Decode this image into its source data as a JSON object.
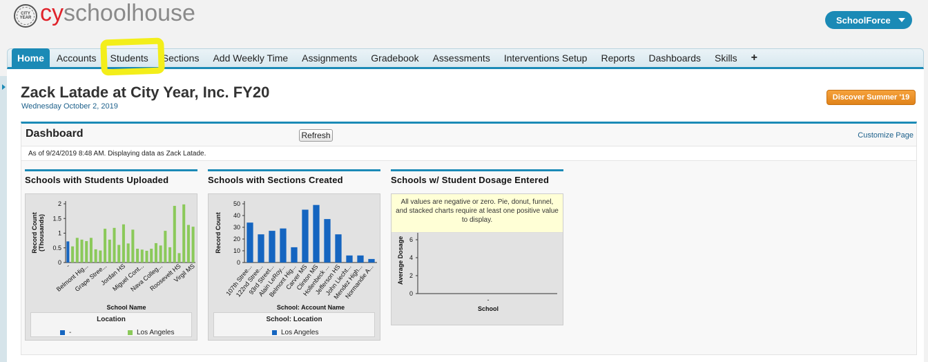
{
  "header": {
    "logo_seal_text": "CITY YEAR",
    "logo_cy": "cy",
    "logo_rest": "schoolhouse",
    "app_switcher": "SchoolForce"
  },
  "tabs": [
    {
      "label": "Home",
      "active": true
    },
    {
      "label": "Accounts"
    },
    {
      "label": "Students"
    },
    {
      "label": "Sections"
    },
    {
      "label": "Add Weekly Time"
    },
    {
      "label": "Assignments"
    },
    {
      "label": "Gradebook"
    },
    {
      "label": "Assessments"
    },
    {
      "label": "Interventions Setup"
    },
    {
      "label": "Reports"
    },
    {
      "label": "Dashboards"
    },
    {
      "label": "Skills"
    },
    {
      "label": "+"
    }
  ],
  "page": {
    "title": "Zack Latade at City Year, Inc. FY20",
    "date": "Wednesday October 2, 2019",
    "promo_button": "Discover Summer '19"
  },
  "dashboard": {
    "title": "Dashboard",
    "refresh_label": "Refresh",
    "customize_label": "Customize Page",
    "info": "As of 9/24/2019 8:48 AM. Displaying data as Zack Latade."
  },
  "colors": {
    "accent": "#1b8ab6",
    "green_series": "#8bc95a",
    "blue_series": "#1565c0",
    "highlight": "#f3ee1a"
  },
  "chart_data": [
    {
      "type": "bar",
      "title": "Schools with Students Uploaded",
      "xlabel": "School Name",
      "ylabel": "Record Count (Thousands)",
      "ylim": [
        0,
        2
      ],
      "yticks": [
        "0",
        "0.5",
        "1",
        "1.5",
        "2"
      ],
      "tick_labels": [
        "-",
        "Belmont Hig...",
        "Grape Stree...",
        "Jordan HS",
        "Miguel Cont...",
        "Nava Colleg...",
        "Roosevelt HS",
        "Virgil MS"
      ],
      "legend_title": "Location",
      "series": [
        {
          "name": "-",
          "values": [
            0.72,
            0,
            0,
            0,
            0,
            0,
            0,
            0,
            0,
            0,
            0,
            0,
            0,
            0,
            0,
            0,
            0,
            0,
            0,
            0,
            0,
            0,
            0,
            0,
            0,
            0,
            0,
            0,
            0,
            0,
            0,
            0,
            0
          ]
        },
        {
          "name": "Los Angeles",
          "values": [
            0,
            0.55,
            0.84,
            0.78,
            0.73,
            0.84,
            0.45,
            0.41,
            1.15,
            0.78,
            1.18,
            0.6,
            1.3,
            0.65,
            1.12,
            0.47,
            0.44,
            0.4,
            0.47,
            0.66,
            0.58,
            1.08,
            0.52,
            1.93,
            0.32,
            1.98,
            1.28,
            1.22
          ]
        }
      ]
    },
    {
      "type": "bar",
      "title": "Schools with Sections Created",
      "xlabel": "School: Account Name",
      "ylabel": "Record Count",
      "ylim": [
        0,
        50
      ],
      "yticks": [
        "0",
        "10",
        "20",
        "30",
        "40",
        "50"
      ],
      "categories": [
        "107th Stree...",
        "122nd Stree...",
        "93rd Street...",
        "Alain LeRoy...",
        "Belmont Hig...",
        "Carver MS",
        "Clinton MS",
        "Hollenbeck ...",
        "Jefferson HS",
        "John Liecht...",
        "Mendez High...",
        "Normandie A..."
      ],
      "legend_title": "School: Location",
      "series": [
        {
          "name": "Los Angeles",
          "values": [
            34,
            24,
            27,
            29,
            13,
            45,
            49,
            37,
            24,
            6,
            6,
            3
          ]
        }
      ]
    },
    {
      "type": "bar",
      "title": "Schools w/ Student Dosage Entered",
      "xlabel": "School",
      "ylabel": "Average Dosage",
      "yticks": [
        "0",
        "2",
        "4",
        "6"
      ],
      "categories": [
        "-"
      ],
      "warning": "All values are negative or zero. Pie, donut, funnel, and stacked charts require at least one positive value to display."
    }
  ]
}
